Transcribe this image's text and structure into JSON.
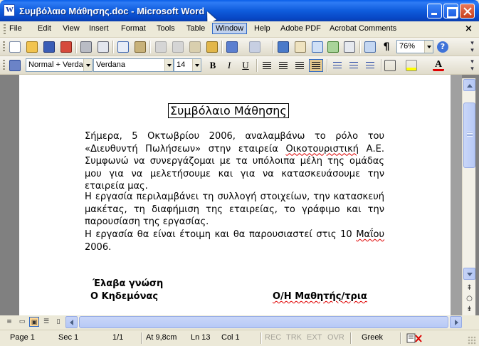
{
  "window": {
    "title": "Συμβόλαιο Μάθησης.doc - Microsoft Word",
    "close_doc_glyph": "×"
  },
  "menu": {
    "items": [
      "File",
      "Edit",
      "View",
      "Insert",
      "Format",
      "Tools",
      "Table",
      "Window",
      "Help",
      "Adobe PDF",
      "Acrobat Comments"
    ],
    "active": "Window"
  },
  "toolbar": {
    "zoom": "76%",
    "paragraph_mark": "¶",
    "help_glyph": "?"
  },
  "formatting": {
    "style": "Normal + Verda",
    "font": "Verdana",
    "size": "14",
    "bold": "B",
    "italic": "I",
    "underline": "U",
    "font_color_glyph": "A"
  },
  "document": {
    "title": "Συμβόλαιο Μάθησης",
    "p1_a": "Σήμερα, 5 Οκτωβρίου 2006, αναλαμβάνω το ρόλο του «Διευθυντή Πωλήσεων» στην εταιρεία ",
    "p1_company": "Οικοτουριστική",
    "p1_b": " Α.Ε. Συμφωνώ να συνεργάζομαι με τα υπόλοιπα μέλη της ομάδας μου για να μελετήσουμε και για να κατασκευάσουμε την εταιρεία μας.",
    "p2": "Η εργασία περιλαμβάνει τη συλλογή στοιχείων, την κατασκευή μακέτας, τη διαφήμιση της εταιρείας, το γράφιμο και την παρουσίαση της εργασίας.",
    "p3_a": "Η εργασία θα είναι έτοιμη και θα παρουσιαστεί στις 10 ",
    "p3_month": "Μαΐου",
    "p3_b": " 2006.",
    "sig_left_1": "Έλαβα γνώση",
    "sig_left_2": "Ο Κηδεμόνας",
    "sig_right": "Ο/Η Μαθητής/τρια"
  },
  "statusbar": {
    "page": "Page 1",
    "sec": "Sec 1",
    "pages": "1/1",
    "at": "At 9,8cm",
    "ln": "Ln 13",
    "col": "Col 1",
    "rec": "REC",
    "trk": "TRK",
    "ext": "EXT",
    "ovr": "OVR",
    "language": "Greek"
  },
  "colors": {
    "title_bar": "#0A5FE8",
    "chrome": "#ECE9D8",
    "spell_error": "#e00000"
  },
  "icons": [
    "new-document-icon",
    "open-folder-icon",
    "save-icon",
    "permission-icon",
    "print-icon",
    "print-preview-icon",
    "spelling-icon",
    "research-icon",
    "cut-icon",
    "copy-icon",
    "paste-icon",
    "format-painter-icon",
    "undo-icon",
    "redo-icon",
    "hyperlink-icon",
    "tables-borders-icon",
    "insert-table-icon",
    "insert-excel-icon",
    "columns-icon",
    "drawing-icon",
    "document-map-icon",
    "show-hide-icon",
    "help-icon"
  ]
}
